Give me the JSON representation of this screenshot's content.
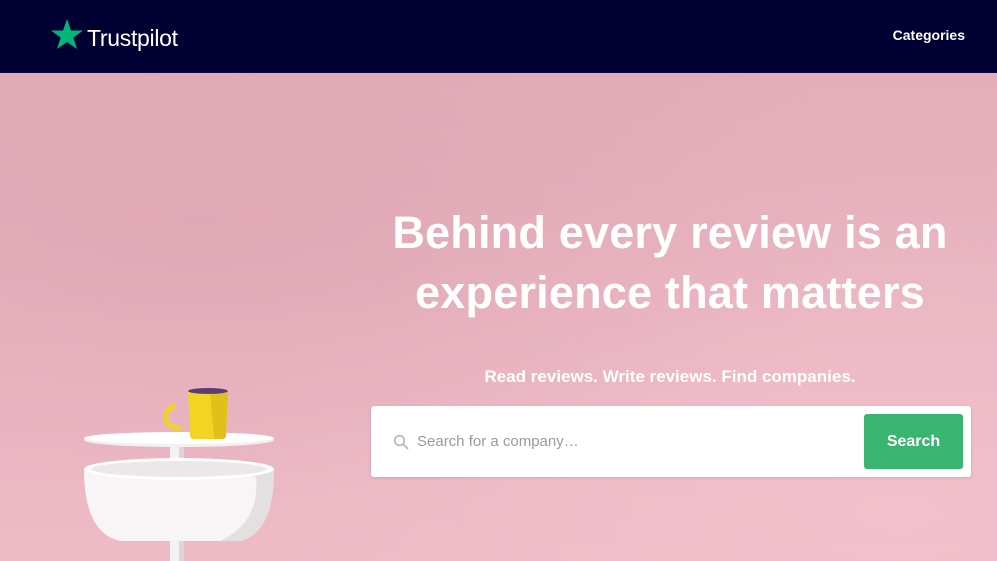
{
  "header": {
    "logo_text": "Trustpilot",
    "nav_categories": "Categories",
    "background_color": "#000032"
  },
  "hero": {
    "title": "Behind every review is an experience that matters",
    "subtitle": "Read reviews. Write reviews. Find companies.",
    "background_color": "#e8b3c0",
    "illustration": "white-side-table-with-yellow-mug"
  },
  "search": {
    "placeholder": "Search for a company…",
    "value": "",
    "button_label": "Search",
    "icon": "search-icon",
    "button_color": "#39b56f"
  },
  "colors": {
    "brand_star": "#00b67a",
    "accent_green": "#39b56f",
    "navy": "#000032"
  }
}
